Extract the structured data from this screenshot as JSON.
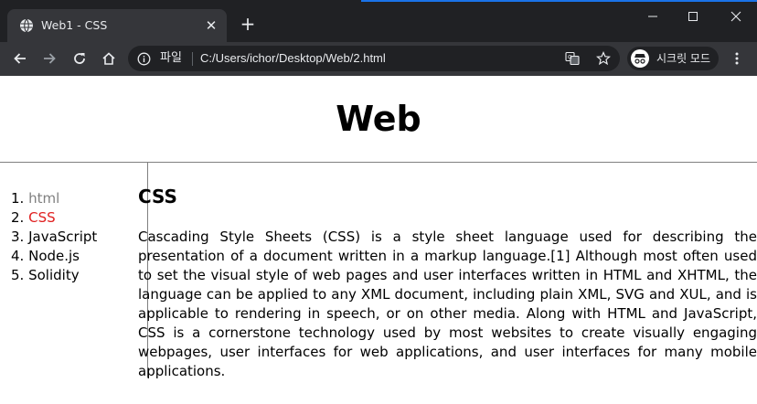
{
  "browser": {
    "tab_title": "Web1 - CSS",
    "new_tab_label": "+",
    "url_scheme": "파일",
    "url": "C:/Users/ichor/Desktop/Web/2.html",
    "incognito_label": "시크릿 모드",
    "colors": {
      "frame": "#202124",
      "toolbar": "#35363a",
      "text": "#e8eaed"
    }
  },
  "page": {
    "title": "Web",
    "nav": [
      {
        "num": "1.",
        "label": "html",
        "state": "visited"
      },
      {
        "num": "2.",
        "label": "CSS",
        "state": "active"
      },
      {
        "num": "3.",
        "label": "JavaScript",
        "state": "plain"
      },
      {
        "num": "4.",
        "label": "Node.js",
        "state": "plain"
      },
      {
        "num": "5.",
        "label": "Solidity",
        "state": "plain"
      }
    ],
    "heading": "CSS",
    "body": "Cascading Style Sheets (CSS) is a style sheet language used for describing the presentation of a document written in a markup language.[1] Although most often used to set the visual style of web pages and user interfaces written in HTML and XHTML, the language can be applied to any XML document, including plain XML, SVG and XUL, and is applicable to rendering in speech, or on other media. Along with HTML and JavaScript, CSS is a cornerstone technology used by most websites to create visually engaging webpages, user interfaces for web applications, and user interfaces for many mobile applications.",
    "colors": {
      "visited_link": "#808080",
      "active_link": "#e02020",
      "rule": "#808080"
    }
  }
}
